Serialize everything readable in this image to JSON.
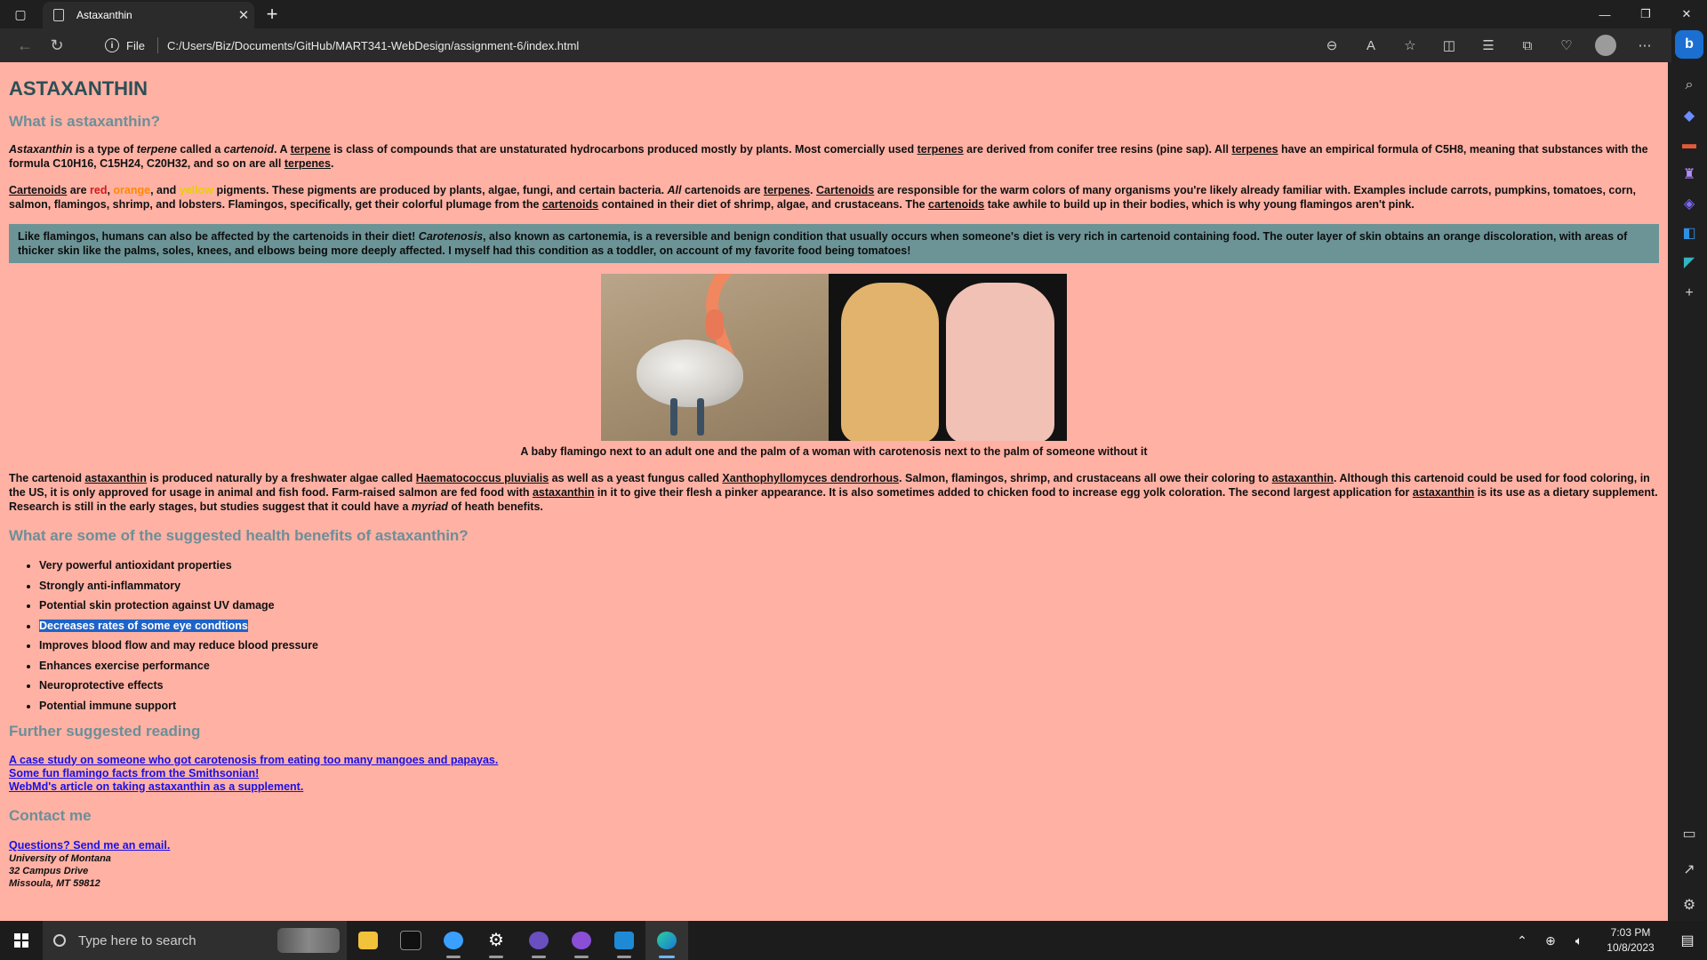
{
  "browser": {
    "tab_title": "Astaxanthin",
    "tab_close": "✕",
    "new_tab": "+",
    "address_scheme": "File",
    "address_url": "C:/Users/Biz/Documents/GitHub/MART341-WebDesign/assignment-6/index.html",
    "window_controls": {
      "minimize": "—",
      "restore": "❐",
      "close": "✕"
    }
  },
  "page": {
    "title": "ASTAXANTHIN",
    "what_heading": "What is astaxanthin?",
    "p1": {
      "astaxanthin": "Astaxanthin",
      "t1": " is a type of ",
      "terpene_em": "terpene",
      "t2": " called a ",
      "cartenoid_em": "cartenoid",
      "t3": ". A ",
      "terpene_u": "terpene",
      "t4": " is class of compounds that are unstaturated hydrocarbons produced mostly by plants. Most comercially used ",
      "terpenes_u1": "terpenes",
      "t5": " are derived from conifer tree resins (pine sap). All ",
      "terpenes_u2": "terpenes",
      "t6": " have an empirical formula of C5H8, meaning that substances with the formula C10H16, C15H24, C20H32, and so on are all ",
      "terpenes_u3": "terpenes",
      "t7": "."
    },
    "p2": {
      "cartenoids_u1": "Cartenoids",
      "t1": " are ",
      "red": "red",
      "t2": ", ",
      "orange": "orange",
      "t3": ", and ",
      "yellow": "yellow",
      "t4": " pigments. These pigments are produced by plants, algae, fungi, and certain bacteria. ",
      "all_em": "All",
      "t5": " cartenoids are ",
      "terpenes_u": "terpenes",
      "t6": ". ",
      "cartenoids_u2": "Cartenoids",
      "t7": " are responsible for the warm colors of many organisms you're likely already familiar with. Examples include carrots, pumpkins, tomatoes, corn, salmon, flamingos, shrimp, and lobsters. Flamingos, specifically, get their colorful plumage from the ",
      "cartenoids_u3": "cartenoids",
      "t8": " contained in their diet of shrimp, algae, and crustaceans. The ",
      "cartenoids_u4": "cartenoids",
      "t9": " take awhile to build up in their bodies, which is why young flamingos aren't pink."
    },
    "callout": {
      "t1": "Like flamingos, humans can also be affected by the cartenoids in their diet! ",
      "carotenosis_em": "Carotenosis",
      "t2": ", also known as cartonemia, is a reversible and benign condition that usually occurs when someone's diet is very rich in cartenoid containing food. The outer layer of skin obtains an orange discoloration, with areas of thicker skin like the palms, soles, knees, and elbows being more deeply affected. I myself had this condition as a toddler, on account of my favorite food being tomatoes!"
    },
    "figure_caption": "A baby flamingo next to an adult one and the palm of a woman with carotenosis next to the palm of someone without it",
    "p3": {
      "t1": "The cartenoid ",
      "astaxanthin_u1": "astaxanthin",
      "t2": " is produced naturally by a freshwater algae called ",
      "haematococcus_u": "Haematococcus pluvialis",
      "t3": " as well as a yeast fungus called ",
      "xantho_u": "Xanthophyllomyces dendrorhous",
      "t4": ". Salmon, flamingos, shrimp, and crustaceans all owe their coloring to ",
      "astaxanthin_u2": "astaxanthin",
      "t5": ". Although this cartenoid could be used for food coloring, in the US, it is only approved for usage in animal and fish food. Farm-raised salmon are fed food with ",
      "astaxanthin_u3": "astaxanthin",
      "t6": " in it to give their flesh a pinker appearance. It is also sometimes added to chicken food to increase egg yolk coloration. The second largest application for ",
      "astaxanthin_u4": "astaxanthin",
      "t7": " is its use as a dietary supplement. Research is still in the early stages, but studies suggest that it could have a ",
      "myriad_em": "myriad",
      "t8": " of heath benefits."
    },
    "benefits_heading": "What are some of the suggested health benefits of astaxanthin?",
    "benefits": [
      "Very powerful antioxidant properties",
      "Strongly anti-inflammatory",
      "Potential skin protection against UV damage",
      "Decreases rates of some eye condtions",
      "Improves blood flow and may reduce blood pressure",
      "Enhances exercise performance",
      "Neuroprotective effects",
      "Potential immune support"
    ],
    "reading_heading": "Further suggested reading",
    "reading_links": [
      "A case study on someone who got carotenosis from eating too many mangoes and papayas.",
      "Some fun flamingo facts from the Smithsonian!",
      "WebMd's article on taking astaxanthin as a supplement."
    ],
    "contact_heading": "Contact me",
    "contact_link": "Questions? Send me an email.",
    "address_lines": [
      "University of Montana",
      "32 Campus Drive",
      "Missoula, MT 59812"
    ]
  },
  "taskbar": {
    "search_placeholder": "Type here to search",
    "time": "7:03 PM",
    "date": "10/8/2023"
  },
  "colors": {
    "page_background": "#ffb1a4",
    "title": "#2d4f55",
    "heading": "#6b8f98",
    "callout_background": "#6c9497",
    "link": "#1a10e8",
    "selection": "#1e63c8"
  }
}
